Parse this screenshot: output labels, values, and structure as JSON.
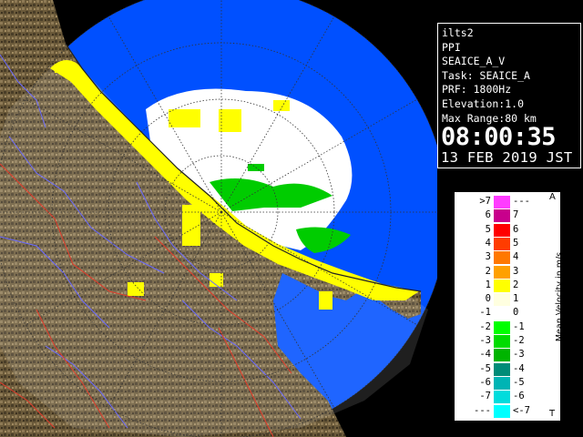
{
  "info": {
    "station": "ilts2",
    "scan_type": "PPI",
    "task": "SEAICE_A_V",
    "task_line": "Task: SEAICE_A",
    "prf": "PRF: 1800Hz",
    "elevation": "Elevation:1.0",
    "max_range": "Max Range:80 km",
    "time": "08:00:35",
    "date": "13 FEB 2019 JST"
  },
  "legend": {
    "title": "Mean Velocity in m/s",
    "top_marker": "A",
    "bottom_marker": "T",
    "rows": [
      {
        "left": ">7",
        "right": "---",
        "color": "#ff3cff"
      },
      {
        "left": "6",
        "right": "7",
        "color": "#c8008c"
      },
      {
        "left": "5",
        "right": "6",
        "color": "#ff0000"
      },
      {
        "left": "4",
        "right": "5",
        "color": "#ff3c00"
      },
      {
        "left": "3",
        "right": "4",
        "color": "#ff7800"
      },
      {
        "left": "2",
        "right": "3",
        "color": "#ffa000"
      },
      {
        "left": "1",
        "right": "2",
        "color": "#ffff00"
      },
      {
        "left": "0",
        "right": "1",
        "color": "#ffffe0"
      },
      {
        "left": "-1",
        "right": "0",
        "color": "#ffffff"
      },
      {
        "left": "-2",
        "right": "-1",
        "color": "#00ff00"
      },
      {
        "left": "-3",
        "right": "-2",
        "color": "#00dc00"
      },
      {
        "left": "-4",
        "right": "-3",
        "color": "#00b400"
      },
      {
        "left": "-5",
        "right": "-4",
        "color": "#008c78"
      },
      {
        "left": "-6",
        "right": "-5",
        "color": "#00b4b4"
      },
      {
        "left": "-7",
        "right": "-6",
        "color": "#00dcdc"
      },
      {
        "left": "---",
        "right": "<-7",
        "color": "#00ffff"
      }
    ]
  },
  "colors": {
    "sea": "#0050ff",
    "land": "#6b5a3a",
    "river": "#6a6aff",
    "boundary": "#e23b2b",
    "range_ring": "#333333"
  }
}
